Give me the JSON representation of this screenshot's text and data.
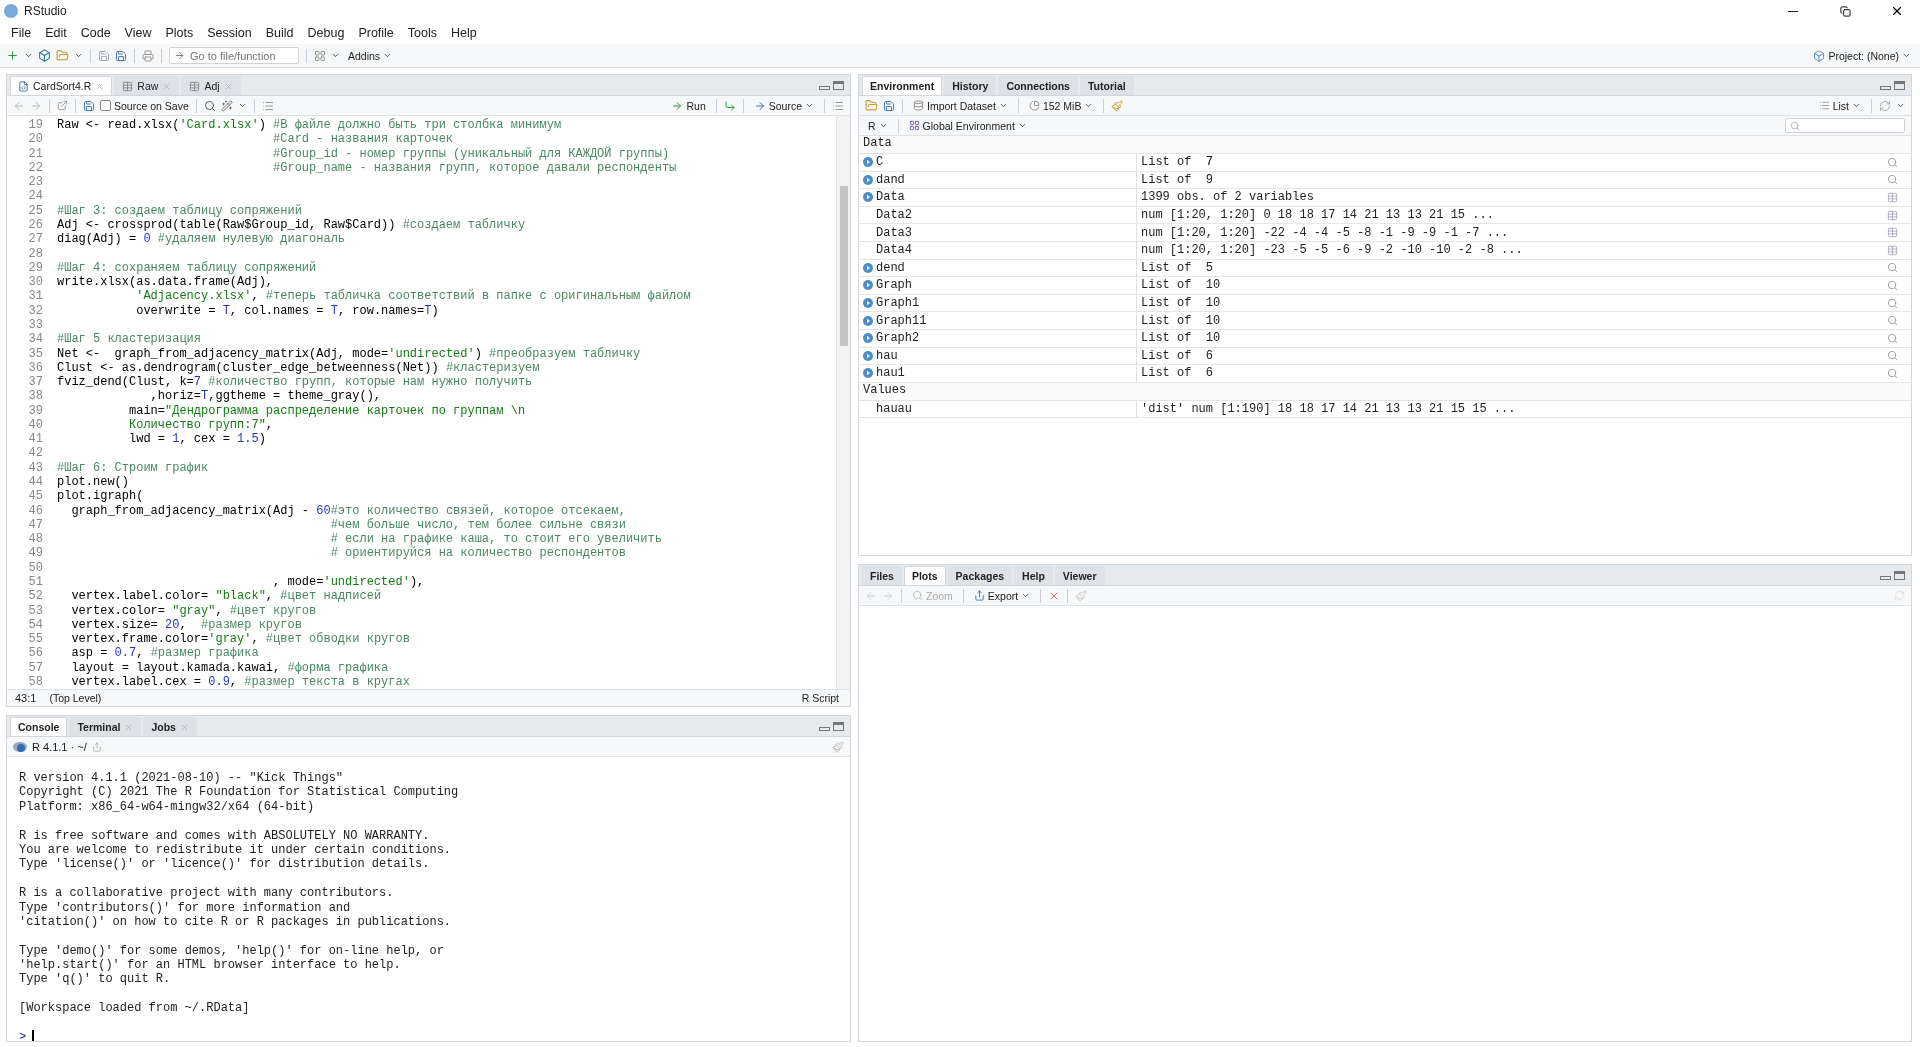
{
  "window": {
    "title": "RStudio"
  },
  "menu": [
    "File",
    "Edit",
    "Code",
    "View",
    "Plots",
    "Session",
    "Build",
    "Debug",
    "Profile",
    "Tools",
    "Help"
  ],
  "toolbar": {
    "goto_placeholder": "Go to file/function",
    "addins": "Addins",
    "project": "Project: (None)"
  },
  "editor": {
    "tabs": [
      {
        "label": "CardSort4.R",
        "kind": "script",
        "selected": true
      },
      {
        "label": "Raw",
        "kind": "table",
        "selected": false
      },
      {
        "label": "Adj",
        "kind": "table",
        "selected": false
      }
    ],
    "source_on_save": {
      "label": "Source on Save",
      "checked": false
    },
    "run": "Run",
    "source": "Source",
    "lines": [
      {
        "n": "19",
        "s": [
          {
            "kind": "code",
            "t": "Raw <- read.xlsx("
          },
          {
            "kind": "string",
            "t": "'Card.xlsx'"
          },
          {
            "kind": "code",
            "t": ") "
          },
          {
            "kind": "comment",
            "t": "#В файле должно быть три столбка минимум"
          }
        ]
      },
      {
        "n": "20",
        "s": [
          {
            "kind": "comment",
            "t": "                              #Card - названия карточек"
          }
        ]
      },
      {
        "n": "21",
        "s": [
          {
            "kind": "comment",
            "t": "                              #Group_id - номер группы (уникальный для КАЖДОЙ группы)"
          }
        ]
      },
      {
        "n": "22",
        "s": [
          {
            "kind": "comment",
            "t": "                              #Group_name - названия групп, которое давали респонденты"
          }
        ]
      },
      {
        "n": "23"
      },
      {
        "n": "24"
      },
      {
        "n": "25",
        "s": [
          {
            "kind": "comment",
            "t": "#Шаг 3: создаем таблицу сопряжений"
          }
        ]
      },
      {
        "n": "26",
        "s": [
          {
            "kind": "code",
            "t": "Adj <- crossprod(table(Raw$Group_id, Raw$Card)) "
          },
          {
            "kind": "comment",
            "t": "#создаем табличку"
          }
        ]
      },
      {
        "n": "27",
        "s": [
          {
            "kind": "code",
            "t": "diag(Adj) = "
          },
          {
            "kind": "number",
            "t": "0"
          },
          {
            "kind": "comment",
            "t": " #удаляем нулевую диагональ"
          }
        ]
      },
      {
        "n": "28"
      },
      {
        "n": "29",
        "s": [
          {
            "kind": "comment",
            "t": "#Шаг 4: сохраняем таблицу сопряжений"
          }
        ]
      },
      {
        "n": "30",
        "s": [
          {
            "kind": "code",
            "t": "write.xlsx(as.data.frame(Adj),"
          }
        ]
      },
      {
        "n": "31",
        "s": [
          {
            "kind": "string",
            "t": "           'Adjacency.xlsx'"
          },
          {
            "kind": "code",
            "t": ", "
          },
          {
            "kind": "comment",
            "t": "#теперь табличка соответствий в папке с оригинальным файлом"
          }
        ]
      },
      {
        "n": "32",
        "s": [
          {
            "kind": "code",
            "t": "           overwrite = "
          },
          {
            "kind": "number",
            "t": "T"
          },
          {
            "kind": "code",
            "t": ", col.names = "
          },
          {
            "kind": "number",
            "t": "T"
          },
          {
            "kind": "code",
            "t": ", row.names="
          },
          {
            "kind": "number",
            "t": "T"
          },
          {
            "kind": "code",
            "t": ")"
          }
        ]
      },
      {
        "n": "33"
      },
      {
        "n": "34",
        "s": [
          {
            "kind": "comment",
            "t": "#Шаг 5 кластеризация"
          }
        ]
      },
      {
        "n": "35",
        "s": [
          {
            "kind": "code",
            "t": "Net <-  graph_from_adjacency_matrix(Adj, mode="
          },
          {
            "kind": "string",
            "t": "'undirected'"
          },
          {
            "kind": "code",
            "t": ") "
          },
          {
            "kind": "comment",
            "t": "#преобразуем табличку"
          }
        ]
      },
      {
        "n": "36",
        "s": [
          {
            "kind": "code",
            "t": "Clust <- as.dendrogram(cluster_edge_betweenness(Net)) "
          },
          {
            "kind": "comment",
            "t": "#кластеризуем"
          }
        ]
      },
      {
        "n": "37",
        "s": [
          {
            "kind": "code",
            "t": "fviz_dend(Clust, k="
          },
          {
            "kind": "number",
            "t": "7"
          },
          {
            "kind": "comment",
            "t": " #количество групп, которые нам нужно получить"
          }
        ]
      },
      {
        "n": "38",
        "s": [
          {
            "kind": "code",
            "t": "             ,horiz="
          },
          {
            "kind": "number",
            "t": "T"
          },
          {
            "kind": "code",
            "t": ",ggtheme = theme_gray(),"
          }
        ]
      },
      {
        "n": "39",
        "s": [
          {
            "kind": "code",
            "t": "          main="
          },
          {
            "kind": "string",
            "t": "\"Дендрограмма распределение карточек по группам \\n"
          }
        ]
      },
      {
        "n": "40",
        "s": [
          {
            "kind": "string",
            "t": "          Количество групп:7\""
          },
          {
            "kind": "code",
            "t": ","
          }
        ]
      },
      {
        "n": "41",
        "s": [
          {
            "kind": "code",
            "t": "          lwd = "
          },
          {
            "kind": "number",
            "t": "1"
          },
          {
            "kind": "code",
            "t": ", cex = "
          },
          {
            "kind": "number",
            "t": "1.5"
          },
          {
            "kind": "code",
            "t": ")"
          }
        ]
      },
      {
        "n": "42"
      },
      {
        "n": "43",
        "s": [
          {
            "kind": "comment",
            "t": "#Шаг 6: Строим график"
          }
        ]
      },
      {
        "n": "44",
        "s": [
          {
            "kind": "code",
            "t": "plot.new()"
          }
        ]
      },
      {
        "n": "45",
        "s": [
          {
            "kind": "code",
            "t": "plot.igraph("
          }
        ]
      },
      {
        "n": "46",
        "s": [
          {
            "kind": "code",
            "t": "  graph_from_adjacency_matrix(Adj - "
          },
          {
            "kind": "number",
            "t": "60"
          },
          {
            "kind": "comment",
            "t": "#это количество связей, которое отсекаем,"
          }
        ]
      },
      {
        "n": "47",
        "s": [
          {
            "kind": "comment",
            "t": "                                      #чем больше число, тем более сильне связи"
          }
        ]
      },
      {
        "n": "48",
        "s": [
          {
            "kind": "comment",
            "t": "                                      # если на графике каша, то стоит его увеличить"
          }
        ]
      },
      {
        "n": "49",
        "s": [
          {
            "kind": "comment",
            "t": "                                      # ориентируйся на количество респондентов"
          }
        ]
      },
      {
        "n": "50"
      },
      {
        "n": "51",
        "s": [
          {
            "kind": "code",
            "t": "                              , mode="
          },
          {
            "kind": "string",
            "t": "'undirected'"
          },
          {
            "kind": "code",
            "t": "),"
          }
        ]
      },
      {
        "n": "52",
        "s": [
          {
            "kind": "code",
            "t": "  vertex.label.color= "
          },
          {
            "kind": "string",
            "t": "\"black\""
          },
          {
            "kind": "code",
            "t": ", "
          },
          {
            "kind": "comment",
            "t": "#цвет надписей"
          }
        ]
      },
      {
        "n": "53",
        "s": [
          {
            "kind": "code",
            "t": "  vertex.color= "
          },
          {
            "kind": "string",
            "t": "\"gray\""
          },
          {
            "kind": "code",
            "t": ", "
          },
          {
            "kind": "comment",
            "t": "#цвет кругов"
          }
        ]
      },
      {
        "n": "54",
        "s": [
          {
            "kind": "code",
            "t": "  vertex.size= "
          },
          {
            "kind": "number",
            "t": "20"
          },
          {
            "kind": "code",
            "t": ",  "
          },
          {
            "kind": "comment",
            "t": "#размер кругов"
          }
        ]
      },
      {
        "n": "55",
        "s": [
          {
            "kind": "code",
            "t": "  vertex.frame.color="
          },
          {
            "kind": "string",
            "t": "'gray'"
          },
          {
            "kind": "code",
            "t": ", "
          },
          {
            "kind": "comment",
            "t": "#цвет обводки кругов"
          }
        ]
      },
      {
        "n": "56",
        "s": [
          {
            "kind": "code",
            "t": "  asp = "
          },
          {
            "kind": "number",
            "t": "0.7"
          },
          {
            "kind": "code",
            "t": ", "
          },
          {
            "kind": "comment",
            "t": "#размер графика"
          }
        ]
      },
      {
        "n": "57",
        "s": [
          {
            "kind": "code",
            "t": "  layout = layout.kamada.kawai, "
          },
          {
            "kind": "comment",
            "t": "#форма графика"
          }
        ]
      },
      {
        "n": "58",
        "s": [
          {
            "kind": "code",
            "t": "  vertex.label.cex = "
          },
          {
            "kind": "number",
            "t": "0.9"
          },
          {
            "kind": "code",
            "t": ", "
          },
          {
            "kind": "comment",
            "t": "#размер текста в кругах"
          }
        ]
      }
    ],
    "status": {
      "position": "43:1",
      "scope": "(Top Level)",
      "type": "R Script"
    }
  },
  "console": {
    "tabs": [
      {
        "label": "Console",
        "closable": false,
        "selected": true
      },
      {
        "label": "Terminal",
        "closable": true,
        "selected": false
      },
      {
        "label": "Jobs",
        "closable": true,
        "selected": false
      }
    ],
    "info": "R 4.1.1 · ~/",
    "paragraphs": [
      [
        "R version 4.1.1 (2021-08-10) -- \"Kick Things\"",
        "Copyright (C) 2021 The R Foundation for Statistical Computing",
        "Platform: x86_64-w64-mingw32/x64 (64-bit)"
      ],
      [
        "R is free software and comes with ABSOLUTELY NO WARRANTY.",
        "You are welcome to redistribute it under certain conditions.",
        "Type 'license()' or 'licence()' for distribution details."
      ],
      [
        "R is a collaborative project with many contributors.",
        "Type 'contributors()' for more information and",
        "'citation()' on how to cite R or R packages in publications."
      ],
      [
        "Type 'demo()' for some demos, 'help()' for on-line help, or",
        "'help.start()' for an HTML browser interface to help.",
        "Type 'q()' to quit R."
      ],
      [
        "[Workspace loaded from ~/.RData]"
      ]
    ],
    "prompt": ">"
  },
  "environment": {
    "tabs": [
      {
        "label": "Environment",
        "selected": true
      },
      {
        "label": "History",
        "selected": false
      },
      {
        "label": "Connections",
        "selected": false
      },
      {
        "label": "Tutorial",
        "selected": false
      }
    ],
    "import": "Import Dataset",
    "memory": "152 MiB",
    "view": "List",
    "language": "R",
    "scope": "Global Environment",
    "sections": [
      {
        "title": "Data",
        "rows": [
          {
            "name": "C",
            "value": "List of  7",
            "expandable": true,
            "kind": "list"
          },
          {
            "name": "dand",
            "value": "List of  9",
            "expandable": true,
            "kind": "list"
          },
          {
            "name": "Data",
            "value": "1399 obs. of 2 variables",
            "expandable": true,
            "kind": "dataframe"
          },
          {
            "name": "Data2",
            "value": "num [1:20, 1:20] 0 18 18 17 14 21 13 13 21 15 ...",
            "expandable": false,
            "kind": "matrix"
          },
          {
            "name": "Data3",
            "value": "num [1:20, 1:20] -22 -4 -4 -5 -8 -1 -9 -9 -1 -7 ...",
            "expandable": false,
            "kind": "matrix"
          },
          {
            "name": "Data4",
            "value": "num [1:20, 1:20] -23 -5 -5 -6 -9 -2 -10 -10 -2 -8 ...",
            "expandable": false,
            "kind": "matrix"
          },
          {
            "name": "dend",
            "value": "List of  5",
            "expandable": true,
            "kind": "list"
          },
          {
            "name": "Graph",
            "value": "List of  10",
            "expandable": true,
            "kind": "list"
          },
          {
            "name": "Graph1",
            "value": "List of  10",
            "expandable": true,
            "kind": "list"
          },
          {
            "name": "Graph11",
            "value": "List of  10",
            "expandable": true,
            "kind": "list"
          },
          {
            "name": "Graph2",
            "value": "List of  10",
            "expandable": true,
            "kind": "list"
          },
          {
            "name": "hau",
            "value": "List of  6",
            "expandable": true,
            "kind": "list"
          },
          {
            "name": "hau1",
            "value": "List of  6",
            "expandable": true,
            "kind": "list"
          }
        ]
      },
      {
        "title": "Values",
        "rows": [
          {
            "name": "hauau",
            "value": "'dist' num [1:190] 18 18 17 14 21 13 13 21 15 15 ...",
            "expandable": false,
            "kind": "value"
          }
        ]
      }
    ]
  },
  "files": {
    "tabs": [
      {
        "label": "Files",
        "selected": false
      },
      {
        "label": "Plots",
        "selected": true
      },
      {
        "label": "Packages",
        "selected": false
      },
      {
        "label": "Help",
        "selected": false
      },
      {
        "label": "Viewer",
        "selected": false
      }
    ],
    "zoom": "Zoom",
    "export": "Export"
  }
}
